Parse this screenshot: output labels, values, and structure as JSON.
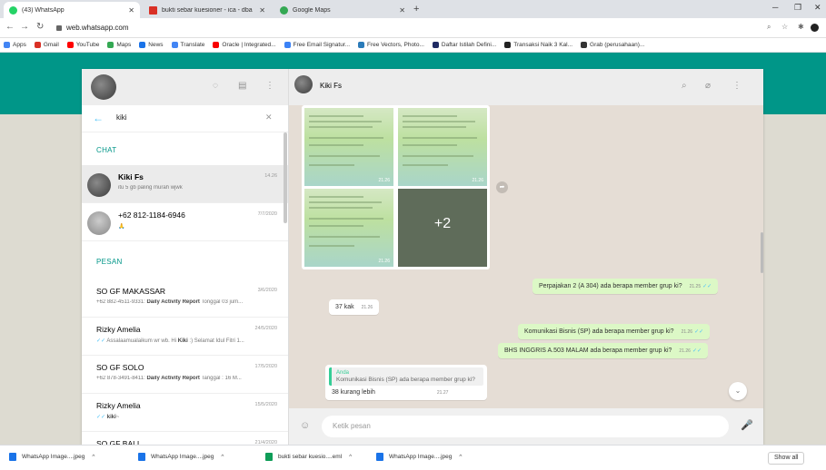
{
  "browser": {
    "tabs": [
      {
        "title": "(43) WhatsApp",
        "color": "#25d366",
        "active": true
      },
      {
        "title": "bukti sebar kuesioner - ica - dba",
        "color": "#d93025",
        "active": false
      },
      {
        "title": "Google Maps",
        "color": "#34a853",
        "active": false
      }
    ],
    "url": "web.whatsapp.com",
    "bookmarks": [
      {
        "label": "Apps",
        "color": "#4285f4"
      },
      {
        "label": "Gmail",
        "color": "#d93025"
      },
      {
        "label": "YouTube",
        "color": "#ff0000"
      },
      {
        "label": "Maps",
        "color": "#34a853"
      },
      {
        "label": "News",
        "color": "#1a73e8"
      },
      {
        "label": "Translate",
        "color": "#4285f4"
      },
      {
        "label": "Oracle | Integrated...",
        "color": "#f80000"
      },
      {
        "label": "Free Email Signatur...",
        "color": "#3b82f6"
      },
      {
        "label": "Free Vectors, Photo...",
        "color": "#2b7bb9"
      },
      {
        "label": "Daftar Istilah Defini...",
        "color": "#1f2b63"
      },
      {
        "label": "Transaksi Naik 3 Kal...",
        "color": "#222222"
      },
      {
        "label": "Grab (perusahaan)...",
        "color": "#333333"
      }
    ]
  },
  "sidebar": {
    "search_query": "kiki",
    "section_chats": "CHAT",
    "section_messages": "PESAN",
    "chats": [
      {
        "name": "Kiki Fs",
        "time": "14.26",
        "msg": "itu 5 gb paling murah wjwk"
      },
      {
        "name": "+62 812-1184-6946",
        "time": "7/7/2020",
        "msg": "🙏"
      }
    ],
    "messages": [
      {
        "name": "SO GF MAKASSAR",
        "time": "3/6/2020",
        "pre": "+62 882-4511-9331: ",
        "bold": "Daily Activity Report",
        "post": " Tonggal 03 jum..."
      },
      {
        "name": "Rizky Amelia",
        "time": "24/5/2020",
        "pre": "Assalaamualaikum wr wb. Hi ",
        "bold": "Kiki",
        "post": " :) Selamat Idul Fitri 1..."
      },
      {
        "name": "SO GF SOLO",
        "time": "17/5/2020",
        "pre": "+62 878-3491-8411: ",
        "bold": "Daily Activity Report",
        "post": " Tanggal : 16 M..."
      },
      {
        "name": "Rizky Amelia",
        "time": "15/5/2020",
        "pre": "",
        "bold": "kiki",
        "post": "~"
      },
      {
        "name": "SO GF BALI",
        "time": "21/4/2020",
        "pre": "Chand ADM GF Bali: Daily report Bali, 21 april 2020 Nama ...",
        "bold": "",
        "post": ""
      }
    ]
  },
  "chat": {
    "contact": "Kiki Fs",
    "album_more": "+2",
    "album_times": [
      "21.26",
      "21.26",
      "21.26"
    ],
    "messages": [
      {
        "text": "Perpajakan 2 (A 304) ada berapa member grup ki?",
        "time": "21.25"
      },
      {
        "text": "37 kak",
        "time": "21.26"
      },
      {
        "text": "Komunikasi Bisnis (SP) ada berapa member grup ki?",
        "time": "21.26"
      },
      {
        "text": "BHS INGGRIS A.503 MALAM ada berapa member grup ki?",
        "time": "21.26"
      },
      {
        "quote_name": "Anda",
        "quote_text": "Komunikasi Bisnis (SP) ada berapa member grup ki?",
        "text": "38 kurang lebih",
        "time": "21.27"
      }
    ],
    "composer_placeholder": "Ketik pesan"
  },
  "downloads": {
    "items": [
      "WhatsApp Image....jpeg",
      "WhatsApp Image....jpeg",
      "bukti sebar kuesio....eml",
      "WhatsApp Image....jpeg"
    ],
    "show_all": "Show all"
  }
}
